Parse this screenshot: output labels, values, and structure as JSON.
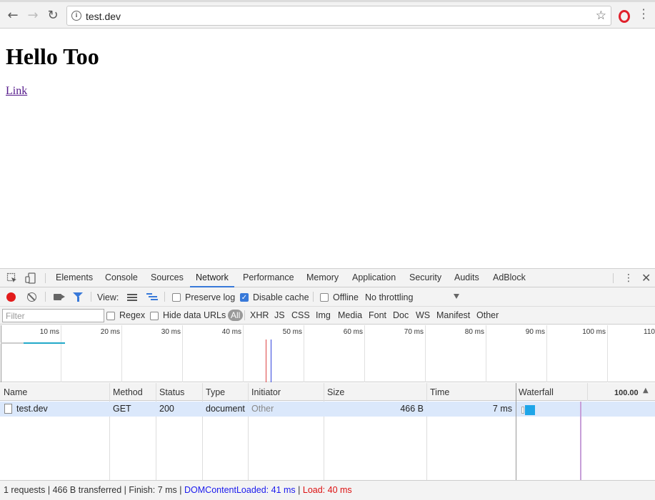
{
  "browser": {
    "url": "test.dev"
  },
  "page": {
    "heading": "Hello Too",
    "link_text": "Link"
  },
  "devtools": {
    "tabs": [
      "Elements",
      "Console",
      "Sources",
      "Network",
      "Performance",
      "Memory",
      "Application",
      "Security",
      "Audits",
      "AdBlock"
    ],
    "active_tab": "Network",
    "toolbar": {
      "view_label": "View:",
      "preserve_log": "Preserve log",
      "disable_cache": "Disable cache",
      "offline": "Offline",
      "throttling": "No throttling"
    },
    "filter": {
      "placeholder": "Filter",
      "regex": "Regex",
      "hide_data_urls": "Hide data URLs",
      "types": [
        "All",
        "XHR",
        "JS",
        "CSS",
        "Img",
        "Media",
        "Font",
        "Doc",
        "WS",
        "Manifest",
        "Other"
      ]
    },
    "overview_ticks": [
      "10 ms",
      "20 ms",
      "30 ms",
      "40 ms",
      "50 ms",
      "60 ms",
      "70 ms",
      "80 ms",
      "90 ms",
      "100 ms",
      "110"
    ],
    "columns": {
      "name": "Name",
      "method": "Method",
      "status": "Status",
      "type": "Type",
      "initiator": "Initiator",
      "size": "Size",
      "time": "Time",
      "waterfall": "Waterfall",
      "scale": "100.00"
    },
    "rows": [
      {
        "name": "test.dev",
        "method": "GET",
        "status": "200",
        "type": "document",
        "initiator": "Other",
        "size": "466 B",
        "time": "7 ms"
      }
    ],
    "summary": {
      "requests": "1 requests",
      "transferred": "466 B transferred",
      "finish": "Finish: 7 ms",
      "dcl": "DOMContentLoaded: 41 ms",
      "load": "Load: 40 ms",
      "separator": "|"
    },
    "colors": {
      "accent": "#3879d9",
      "record": "#e21b1b",
      "dcl": "#1a1aee",
      "load": "#dd1111"
    }
  }
}
